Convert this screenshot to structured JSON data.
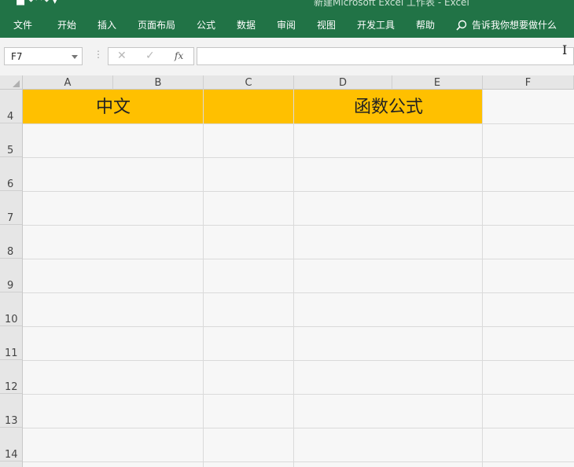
{
  "titlebar": {
    "title": "新建Microsoft Excel 工作表 - Excel"
  },
  "ribbon": {
    "tabs": [
      {
        "label": "文件"
      },
      {
        "label": "开始"
      },
      {
        "label": "插入"
      },
      {
        "label": "页面布局"
      },
      {
        "label": "公式"
      },
      {
        "label": "数据"
      },
      {
        "label": "审阅"
      },
      {
        "label": "视图"
      },
      {
        "label": "开发工具"
      },
      {
        "label": "帮助"
      }
    ],
    "tell_me": "告诉我你想要做什么"
  },
  "formula_bar": {
    "name_box": "F7",
    "formula": "",
    "fx_label": "fx"
  },
  "columns": [
    "A",
    "B",
    "C",
    "D",
    "E",
    "F"
  ],
  "rows": [
    "4",
    "5",
    "6",
    "7",
    "8",
    "9",
    "10",
    "11",
    "12",
    "13",
    "14"
  ],
  "cells": {
    "A4": "中文",
    "D4": "函数公式"
  },
  "colors": {
    "ribbon": "#217346",
    "header_fill": "#ffc000"
  }
}
